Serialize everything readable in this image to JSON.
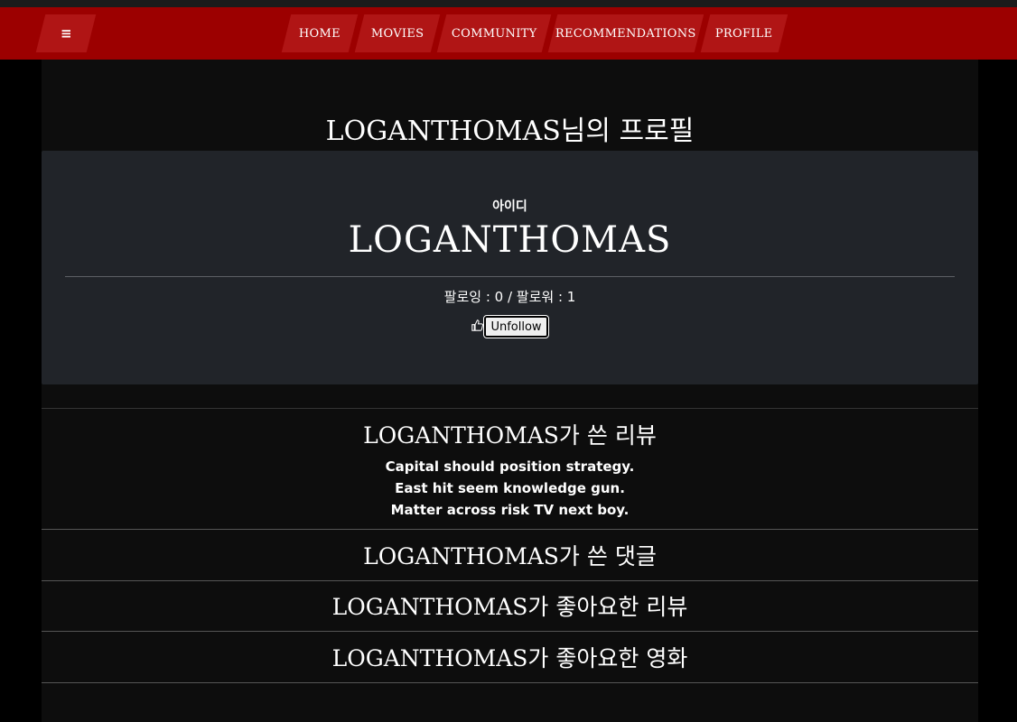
{
  "nav": {
    "menu_icon": "≡",
    "items": [
      "HOME",
      "MOVIES",
      "COMMUNITY",
      "RECOMMENDATIONS",
      "PROFILE"
    ]
  },
  "page": {
    "title": "LOGANTHOMAS님의 프로필"
  },
  "profile": {
    "id_label": "아이디",
    "username": "LOGANTHOMAS",
    "follow_text": "팔로잉 : 0 / 팔로워 : 1",
    "like_icon": "thumbs-up-icon",
    "unfollow_label": "Unfollow"
  },
  "sections": {
    "reviews_title": "LOGANTHOMAS가 쓴 리뷰",
    "reviews": [
      "Capital should position strategy.",
      "East hit seem knowledge gun.",
      "Matter across risk TV next boy."
    ],
    "comments_title": "LOGANTHOMAS가 쓴 댓글",
    "liked_reviews_title": "LOGANTHOMAS가 좋아요한 리뷰",
    "liked_movies_title": "LOGANTHOMAS가 좋아요한 영화"
  },
  "colors": {
    "navbar": "#9c0000",
    "nav_button": "#b01515",
    "card": "#212429",
    "container": "#0d0d0d"
  }
}
